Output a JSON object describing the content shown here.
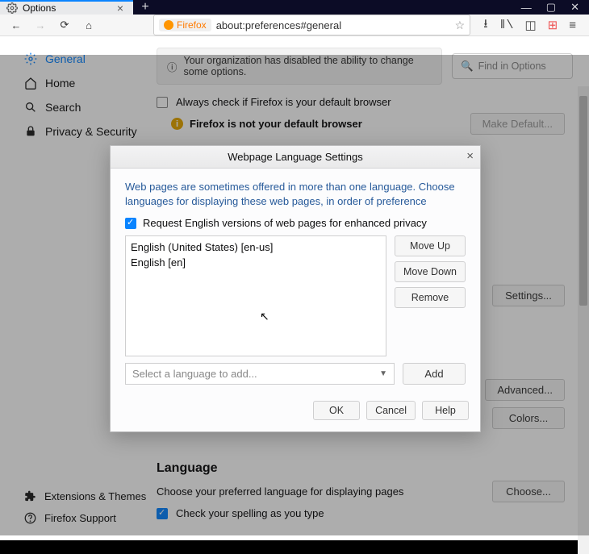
{
  "tab": {
    "title": "Options"
  },
  "url": {
    "brand": "Firefox",
    "value": "about:preferences#general"
  },
  "notice": "Your organization has disabled the ability to change some options.",
  "find_placeholder": "Find in Options",
  "sidebar": {
    "general": "General",
    "home": "Home",
    "search": "Search",
    "privacy": "Privacy & Security",
    "ext": "Extensions & Themes",
    "support": "Firefox Support"
  },
  "default_browser": {
    "check_label": "Always check if Firefox is your default browser",
    "status": "Firefox is not your default browser",
    "make_default": "Make Default..."
  },
  "buttons": {
    "settings": "Settings...",
    "advanced": "Advanced...",
    "colors": "Colors...",
    "choose": "Choose..."
  },
  "language_section": {
    "title": "Language",
    "desc": "Choose your preferred language for displaying pages",
    "spellcheck": "Check your spelling as you type"
  },
  "dialog": {
    "title": "Webpage Language Settings",
    "desc": "Web pages are sometimes offered in more than one language. Choose languages for displaying these web pages, in order of preference",
    "request_english": "Request English versions of web pages for enhanced privacy",
    "languages": [
      "English (United States) [en-us]",
      "English [en]"
    ],
    "move_up": "Move Up",
    "move_down": "Move Down",
    "remove": "Remove",
    "add_placeholder": "Select a language to add...",
    "add": "Add",
    "ok": "OK",
    "cancel": "Cancel",
    "help": "Help"
  }
}
